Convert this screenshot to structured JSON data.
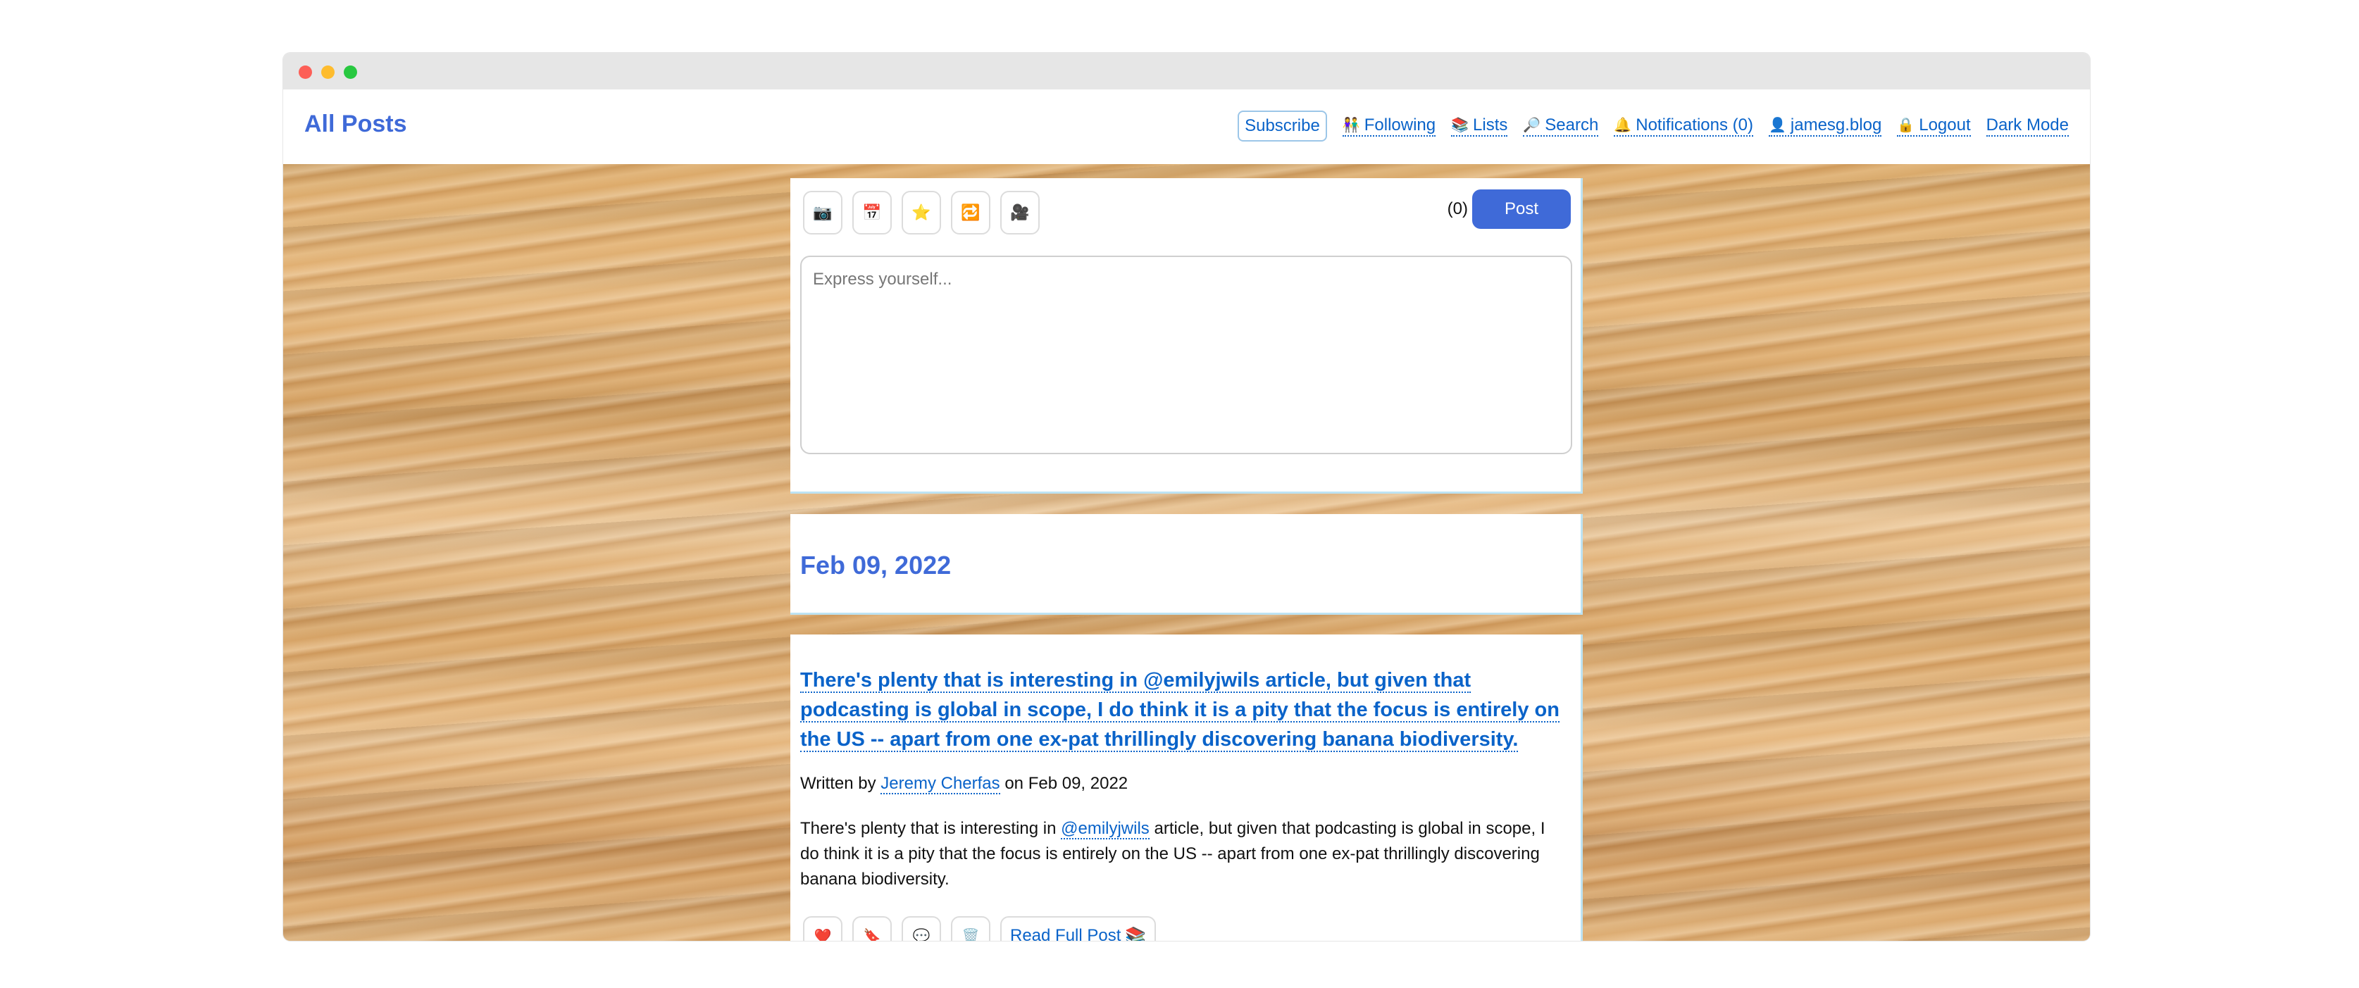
{
  "window": {
    "controls": [
      "close",
      "minimize",
      "maximize"
    ]
  },
  "header": {
    "title": "All Posts",
    "nav": {
      "subscribe": "Subscribe",
      "following": "Following",
      "following_icon": "👫",
      "lists": "Lists",
      "lists_icon": "📚",
      "search": "Search",
      "search_icon": "🔎",
      "notifications": "Notifications (0)",
      "notifications_icon": "🔔",
      "profile": "jamesg.blog",
      "profile_icon": "👤",
      "logout": "Logout",
      "logout_icon": "🔒",
      "dark_mode": "Dark Mode"
    }
  },
  "composer": {
    "tools": [
      {
        "name": "photo-icon",
        "glyph": "📷"
      },
      {
        "name": "calendar-icon",
        "glyph": "📅"
      },
      {
        "name": "star-icon",
        "glyph": "⭐"
      },
      {
        "name": "repost-icon",
        "glyph": "🔁"
      },
      {
        "name": "video-icon",
        "glyph": "🎥"
      }
    ],
    "char_count": "(0)",
    "post_label": "Post",
    "placeholder": "Express yourself..."
  },
  "feed": {
    "date_heading": "Feb 09, 2022",
    "post": {
      "title": "There's plenty that is interesting in @emilyjwils article, but given that podcasting is global in scope, I do think it is a pity that the focus is entirely on the US -- apart from one ex-pat thrillingly discovering banana biodiversity.",
      "byline_prefix": "Written by",
      "author": "Jeremy Cherfas",
      "byline_suffix": "on Feb 09, 2022",
      "body_prefix": "There's plenty that is interesting in",
      "body_mention": "@emilyjwils",
      "body_suffix": "article, but given that podcasting is global in scope, I do think it is a pity that the focus is entirely on the US -- apart from one ex-pat thrillingly discovering banana biodiversity.",
      "actions": [
        {
          "name": "like-icon",
          "glyph": "❤️"
        },
        {
          "name": "bookmark-icon",
          "glyph": "🔖"
        },
        {
          "name": "reply-icon",
          "glyph": "💬"
        },
        {
          "name": "delete-icon",
          "glyph": "🗑️"
        }
      ],
      "read_full": "Read Full Post",
      "read_full_icon": "📚"
    }
  },
  "colors": {
    "brand": "#3f6ad8",
    "link": "#0a63c9",
    "card_border": "#bde3f3"
  }
}
